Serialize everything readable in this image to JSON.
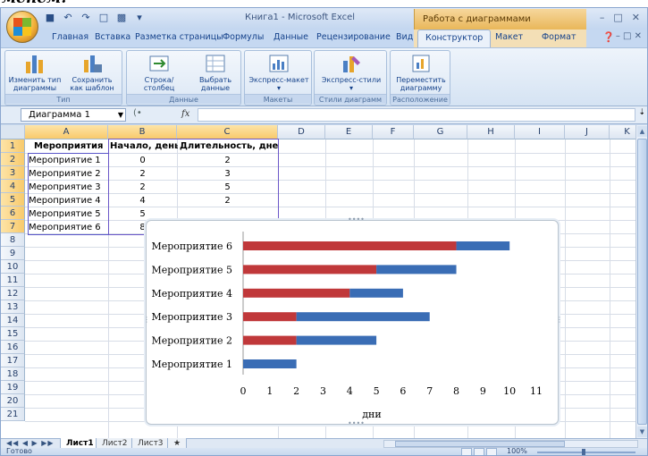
{
  "fragment_top": "менем.",
  "window": {
    "title": "Книга1 - Microsoft Excel",
    "context_title": "Работа с диаграммами"
  },
  "ribbon_tabs": [
    "Главная",
    "Вставка",
    "Разметка страницы",
    "Формулы",
    "Данные",
    "Рецензирование",
    "Вид",
    "Конструктор",
    "Макет",
    "Формат"
  ],
  "active_tab": "Конструктор",
  "ribbon": {
    "groups": [
      {
        "name": "Тип",
        "buttons": [
          "Изменить тип диаграммы",
          "Сохранить как шаблон"
        ]
      },
      {
        "name": "Данные",
        "buttons": [
          "Строка/столбец",
          "Выбрать данные"
        ]
      },
      {
        "name": "Макеты диаграмм",
        "buttons": [
          "Экспресс-макет"
        ]
      },
      {
        "name": "Стили диаграмм",
        "buttons": [
          "Экспресс-стили"
        ]
      },
      {
        "name": "Расположение",
        "buttons": [
          "Переместить диаграмму"
        ]
      }
    ],
    "btn_change_type_1": "Изменить тип",
    "btn_change_type_2": "диаграммы",
    "btn_save_template_1": "Сохранить",
    "btn_save_template_2": "как шаблон",
    "btn_row_col": "Строка/столбец",
    "btn_select_data_1": "Выбрать",
    "btn_select_data_2": "данные",
    "btn_quick_layout": "Экспресс-макет",
    "btn_quick_styles": "Экспресс-стили",
    "btn_move_chart_1": "Переместить",
    "btn_move_chart_2": "диаграмму"
  },
  "formula_bar": {
    "name_box": "Диаграмма 1",
    "fx": "fx",
    "value": ""
  },
  "sheet": {
    "columns": [
      "A",
      "B",
      "C",
      "D",
      "E",
      "F",
      "G",
      "H",
      "I",
      "J",
      "K"
    ],
    "rows": [
      "1",
      "2",
      "3",
      "4",
      "5",
      "6",
      "7",
      "8",
      "9",
      "10",
      "11",
      "12",
      "13",
      "14",
      "15",
      "16",
      "17",
      "18",
      "19",
      "20",
      "21"
    ],
    "header": [
      "Мероприятия",
      "Начало, день",
      "Длительность, дней"
    ],
    "data": [
      [
        "Мероприятие 1",
        "0",
        "2"
      ],
      [
        "Мероприятие 2",
        "2",
        "3"
      ],
      [
        "Мероприятие 3",
        "2",
        "5"
      ],
      [
        "Мероприятие 4",
        "4",
        "2"
      ],
      [
        "Мероприятие 5",
        "5",
        ""
      ],
      [
        "Мероприятие 6",
        "8",
        ""
      ]
    ]
  },
  "chart_data": {
    "type": "bar",
    "orientation": "horizontal",
    "stacked": true,
    "categories": [
      "Мероприятие 1",
      "Мероприятие 2",
      "Мероприятие 3",
      "Мероприятие 4",
      "Мероприятие 5",
      "Мероприятие 6"
    ],
    "series": [
      {
        "values": [
          0,
          2,
          2,
          4,
          5,
          8
        ],
        "color": "#c0383a"
      },
      {
        "values": [
          2,
          3,
          5,
          2,
          3,
          2
        ],
        "color": "#3a6db5"
      }
    ],
    "xlabel": "дни",
    "xlim": [
      0,
      11
    ],
    "xticks": [
      "0",
      "1",
      "2",
      "3",
      "4",
      "5",
      "6",
      "7",
      "8",
      "9",
      "10",
      "11"
    ],
    "grid": false,
    "legend": "none"
  },
  "sheet_tabs": [
    "Лист1",
    "Лист2",
    "Лист3"
  ],
  "active_sheet": "Лист1",
  "status": {
    "ready": "Готово",
    "zoom": "100%"
  },
  "colors": {
    "accent": "#15428b",
    "series_start": "#c0383a",
    "series_duration": "#3a6db5"
  }
}
